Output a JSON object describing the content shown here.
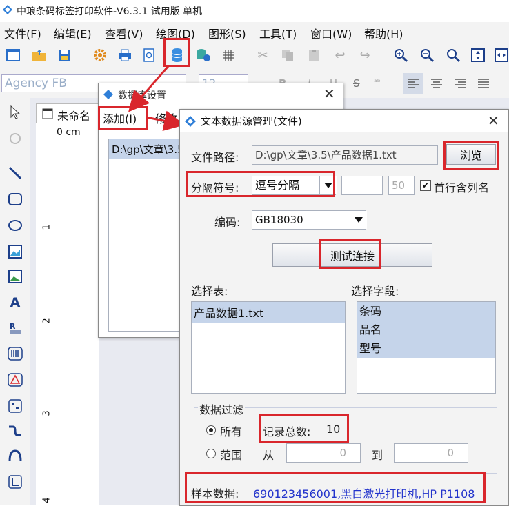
{
  "app": {
    "title": "中琅条码标签打印软件-V6.3.1 试用版 单机"
  },
  "menu": [
    "文件(F)",
    "编辑(E)",
    "查看(V)",
    "绘图(D)",
    "图形(S)",
    "工具(T)",
    "窗口(W)",
    "帮助(H)"
  ],
  "fontbar": {
    "font_name": "Agency FB",
    "font_size": "12"
  },
  "document": {
    "tab_label": "未命名",
    "ruler_unit": "0 cm",
    "ruler_marks": [
      "1",
      "2",
      "3",
      "4"
    ]
  },
  "db_dialog": {
    "title": "数据库设置",
    "add_label": "添加(I)",
    "edit_label": "修改",
    "list_item": "D:\\gp\\文章\\3.5"
  },
  "text_dialog": {
    "title": "文本数据源管理(文件)",
    "path_label": "文件路径:",
    "path_value": "D:\\gp\\文章\\3.5\\产品数据1.txt",
    "browse_label": "浏览",
    "delimiter_label": "分隔符号:",
    "delimiter_value": "逗号分隔",
    "custom_delim_value": "",
    "max_len_value": "50",
    "header_checkbox_label": "首行含列名",
    "header_checked": true,
    "encoding_label": "编码:",
    "encoding_value": "GB18030",
    "test_label": "测试连接",
    "tables_label": "选择表:",
    "tables": [
      "产品数据1.txt"
    ],
    "fields_label": "选择字段:",
    "fields": [
      "条码",
      "品名",
      "型号"
    ],
    "filter_label": "数据过滤",
    "all_label": "所有",
    "range_label": "范围",
    "record_total_label": "记录总数:",
    "record_total_value": "10",
    "from_label": "从",
    "from_value": "0",
    "to_label": "到",
    "to_value": "0",
    "sample_label": "样本数据:",
    "sample_value": "690123456001,黑白激光打印机,HP P1108"
  },
  "colors": {
    "accent_red": "#d9262c",
    "selection": "#c5d4ea",
    "sample_text": "#2233cc"
  }
}
